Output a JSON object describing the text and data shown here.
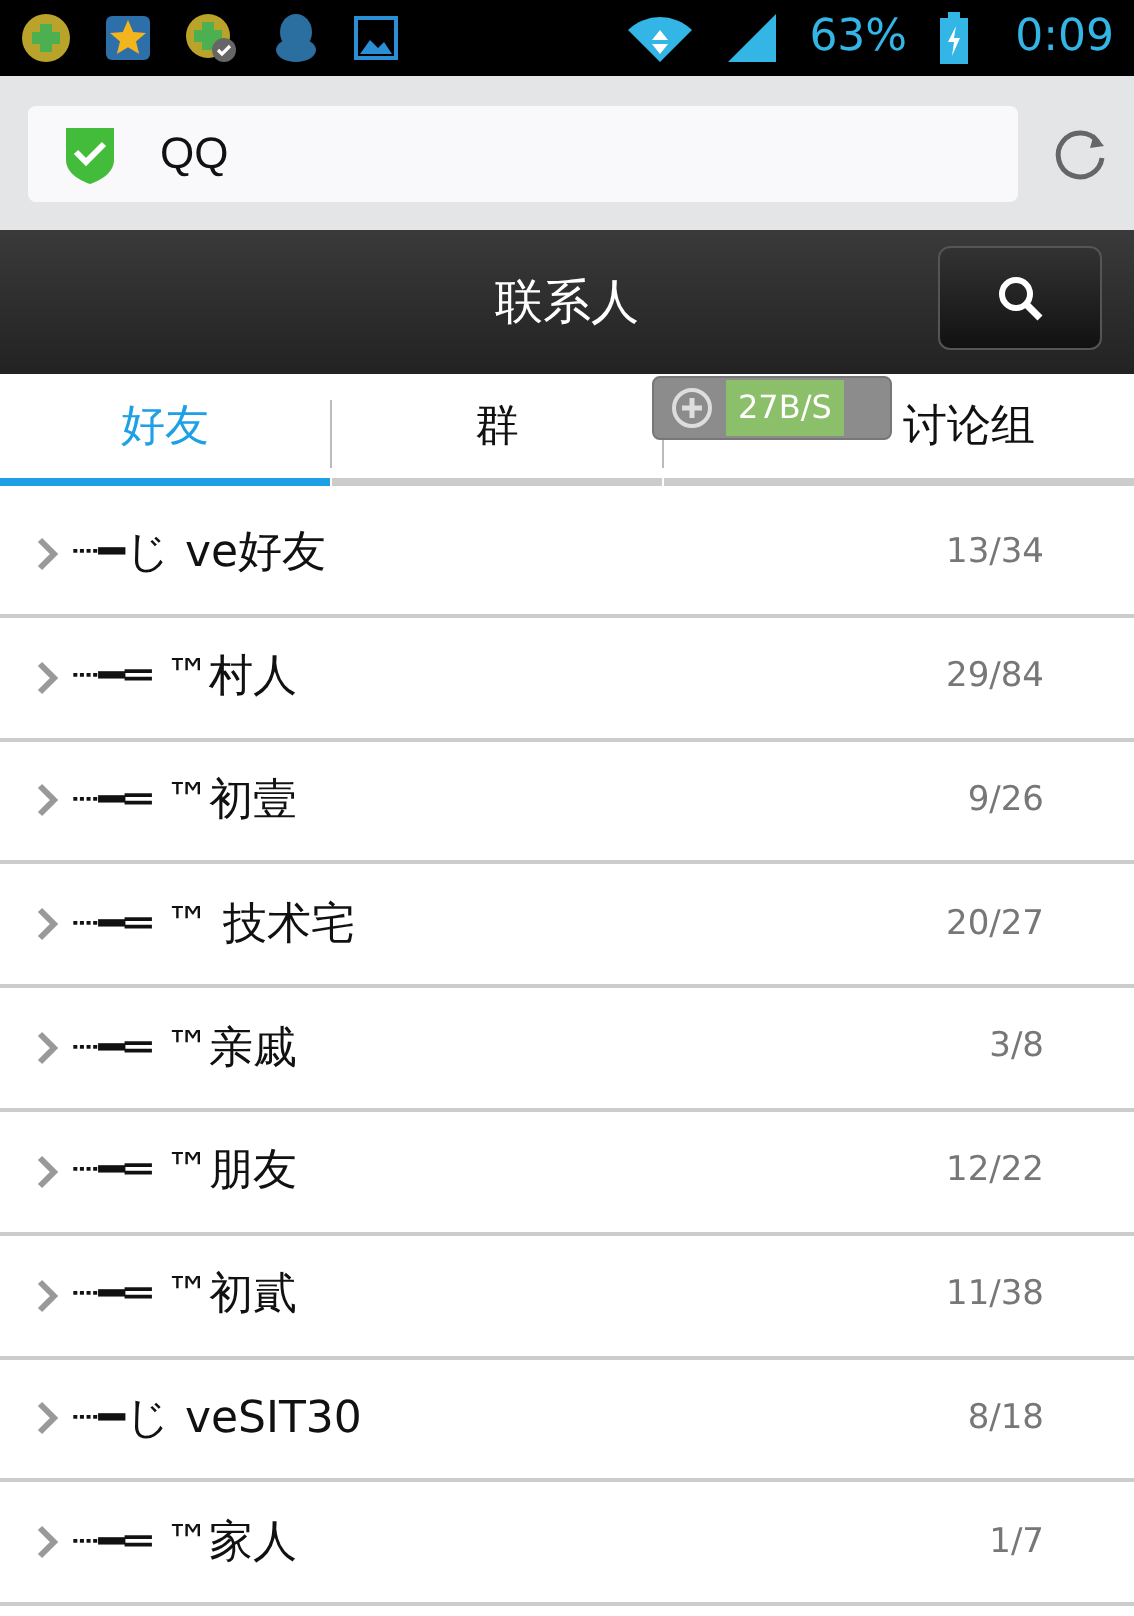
{
  "status_bar": {
    "battery_text": "63%",
    "time": "0:09"
  },
  "address_bar": {
    "value": "QQ"
  },
  "header": {
    "title": "联系人"
  },
  "tabs": [
    {
      "label": "好友",
      "selected": true
    },
    {
      "label": "群",
      "selected": false
    },
    {
      "label": "讨论组",
      "selected": false
    }
  ],
  "speed_overlay": {
    "text": "27B/S"
  },
  "groups": [
    {
      "name": "┈━じ ve好友",
      "count": "13/34",
      "expanded": false
    },
    {
      "name": "┈━═ ™村人",
      "count": "29/84",
      "expanded": false
    },
    {
      "name": "┈━═ ™初壹",
      "count": "9/26",
      "expanded": false
    },
    {
      "name": "┈━═ ™ 技术宅",
      "count": "20/27",
      "expanded": false
    },
    {
      "name": "┈━═ ™亲戚",
      "count": "3/8",
      "expanded": false
    },
    {
      "name": "┈━═ ™朋友",
      "count": "12/22",
      "expanded": false
    },
    {
      "name": "┈━═ ™初貳",
      "count": "11/38",
      "expanded": false
    },
    {
      "name": "┈━じ veSIT30",
      "count": "8/18",
      "expanded": false
    },
    {
      "name": "┈━═ ™家人",
      "count": "1/7",
      "expanded": false
    }
  ]
}
